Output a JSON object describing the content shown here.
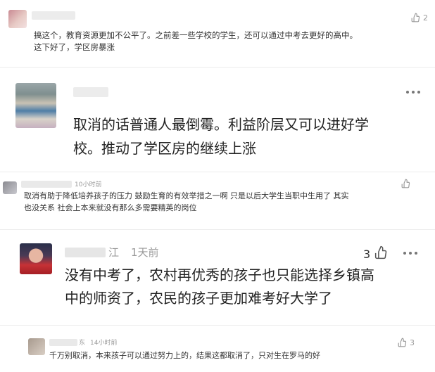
{
  "comments": [
    {
      "text_lines": [
        "搞这个，教育资源更加不公平了。之前差一些学校的学生，还可以通过中考去更好的高中。",
        "这下好了，学区房暴涨"
      ],
      "likes": "2"
    },
    {
      "text_lines": [
        "取消的话普通人最倒霉。利益阶层又可以进好学",
        "校。推动了学区房的继续上涨"
      ],
      "more_icon": "ellipsis-icon"
    },
    {
      "time": "10小时前",
      "text_lines": [
        "取消有助于降低培养孩子的压力 鼓励生育的有效举措之一啊 只是以后大学生当职中生用了 其实",
        "也没关系 社会上本来就没有那么多需要精英的岗位"
      ]
    },
    {
      "name_visible": "江",
      "time": "1天前",
      "likes": "3",
      "text_lines": [
        "没有中考了，农村再优秀的孩子也只能选择乡镇高",
        "中的师资了，农民的孩子更加难考好大学了"
      ],
      "more_icon": "ellipsis-icon"
    },
    {
      "name_visible": "东",
      "time": "14小时前",
      "likes": "3",
      "text_lines": [
        "千万别取消，本来孩子可以通过努力上的，结果这都取消了，只对生在罗马的好"
      ]
    }
  ]
}
